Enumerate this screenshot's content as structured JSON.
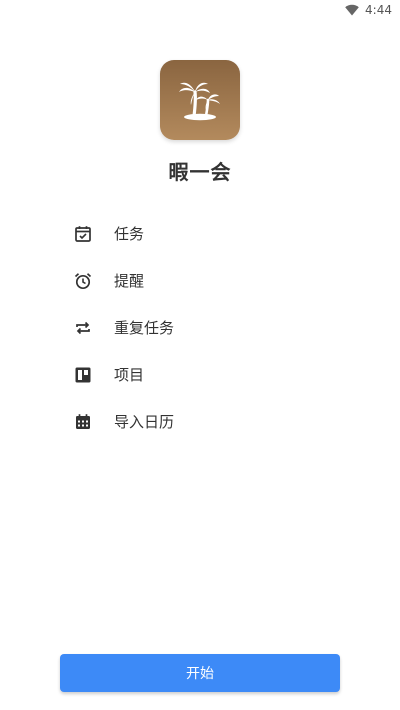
{
  "status_bar": {
    "time": "4:44",
    "icons": [
      "wifi-icon"
    ]
  },
  "app": {
    "name": "暇一会",
    "icon": "palm-tree-icon",
    "icon_colors": [
      "#8a6540",
      "#b38a5d"
    ]
  },
  "features": [
    {
      "label": "任务",
      "icon": "calendar-check-icon"
    },
    {
      "label": "提醒",
      "icon": "alarm-clock-icon"
    },
    {
      "label": "重复任务",
      "icon": "repeat-icon"
    },
    {
      "label": "项目",
      "icon": "board-icon"
    },
    {
      "label": "导入日历",
      "icon": "calendar-grid-icon"
    }
  ],
  "start_button": {
    "label": "开始",
    "color": "#3d8af7"
  }
}
